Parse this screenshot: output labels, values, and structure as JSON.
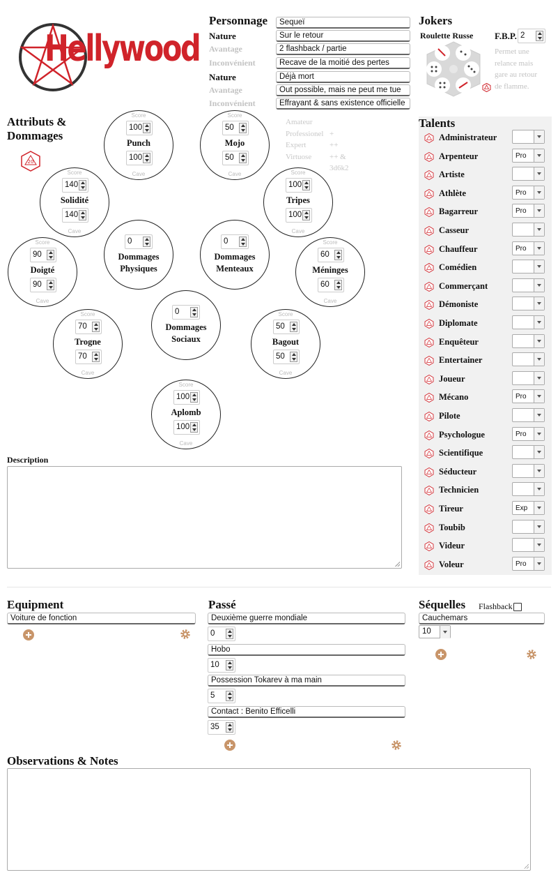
{
  "logo": {
    "text": "Hellywood"
  },
  "personnage": {
    "title": "Personnage",
    "name": "Sequeï",
    "nature_label": "Nature",
    "avantage_label": "Avantage",
    "inconvenient_label": "Inconvénient",
    "nature1": "Sur le retour",
    "avantage1": "2 flashback / partie",
    "inconvenient1": "Recave de la moitié des pertes",
    "nature2": "Déjà mort",
    "avantage2": "Out possible, mais ne peut me tue",
    "inconvenient2": "Effrayant & sans existence officielle"
  },
  "jokers": {
    "title": "Jokers",
    "roulette_label": "Roulette Russe",
    "fbp_label": "F.B.P.",
    "fbp_value": "2",
    "fbp_note": "Permet une relance mais gare au retour de flamme."
  },
  "attributs": {
    "title": "Attributs & Dommages",
    "score_label": "Score",
    "cave_label": "Cave",
    "levels": [
      {
        "name": "Amateur",
        "mod": ""
      },
      {
        "name": "Professionel",
        "mod": "+"
      },
      {
        "name": "Expert",
        "mod": "++"
      },
      {
        "name": "Virtuose",
        "mod": "++ & 3d6k2"
      }
    ],
    "punch": {
      "name": "Punch",
      "score": "100",
      "cave": "100"
    },
    "mojo": {
      "name": "Mojo",
      "score": "50",
      "cave": "50"
    },
    "solidite": {
      "name": "Solidité",
      "score": "140",
      "cave": "140"
    },
    "tripes": {
      "name": "Tripes",
      "score": "100",
      "cave": "100"
    },
    "doigte": {
      "name": "Doigté",
      "score": "90",
      "cave": "90"
    },
    "meninges": {
      "name": "Méninges",
      "score": "60",
      "cave": "60"
    },
    "trogne": {
      "name": "Trogne",
      "score": "70",
      "cave": "70"
    },
    "bagout": {
      "name": "Bagout",
      "score": "50",
      "cave": "50"
    },
    "aplomb": {
      "name": "Aplomb",
      "score": "100",
      "cave": "100"
    },
    "dom_phys": {
      "name1": "Dommages",
      "name2": "Physiques",
      "value": "0"
    },
    "dom_ment": {
      "name1": "Dommages",
      "name2": "Menteaux",
      "value": "0"
    },
    "dom_soc": {
      "name1": "Dommages",
      "name2": "Sociaux",
      "value": "0"
    }
  },
  "talents": {
    "title": "Talents",
    "items": [
      {
        "name": "Administrateur",
        "level": ""
      },
      {
        "name": "Arpenteur",
        "level": "Pro"
      },
      {
        "name": "Artiste",
        "level": ""
      },
      {
        "name": "Athlète",
        "level": "Pro"
      },
      {
        "name": "Bagarreur",
        "level": "Pro"
      },
      {
        "name": "Casseur",
        "level": ""
      },
      {
        "name": "Chauffeur",
        "level": "Pro"
      },
      {
        "name": "Comédien",
        "level": ""
      },
      {
        "name": "Commerçant",
        "level": ""
      },
      {
        "name": "Démoniste",
        "level": ""
      },
      {
        "name": "Diplomate",
        "level": ""
      },
      {
        "name": "Enquêteur",
        "level": ""
      },
      {
        "name": "Entertainer",
        "level": ""
      },
      {
        "name": "Joueur",
        "level": ""
      },
      {
        "name": "Mécano",
        "level": "Pro"
      },
      {
        "name": "Pilote",
        "level": ""
      },
      {
        "name": "Psychologue",
        "level": "Pro"
      },
      {
        "name": "Scientifique",
        "level": ""
      },
      {
        "name": "Séducteur",
        "level": ""
      },
      {
        "name": "Technicien",
        "level": ""
      },
      {
        "name": "Tireur",
        "level": "Exp"
      },
      {
        "name": "Toubib",
        "level": ""
      },
      {
        "name": "Videur",
        "level": ""
      },
      {
        "name": "Voleur",
        "level": "Pro"
      }
    ]
  },
  "description": {
    "title": "Description",
    "value": ""
  },
  "equipment": {
    "title": "Equipment",
    "items": [
      "Voiture de fonction"
    ]
  },
  "passe": {
    "title": "Passé",
    "items": [
      {
        "label": "Deuxième guerre mondiale",
        "value": "0"
      },
      {
        "label": "Hobo",
        "value": "10"
      },
      {
        "label": "Possession Tokarev à ma main",
        "value": "5"
      },
      {
        "label": "Contact : Benito Efficelli",
        "value": "35"
      }
    ]
  },
  "sequelles": {
    "title": "Séquelles",
    "flashback_label": "Flashback",
    "flashback_checked": false,
    "items": [
      {
        "label": "Cauchemars",
        "value": "10"
      }
    ]
  },
  "notes": {
    "title": "Observations & Notes",
    "value": ""
  },
  "colors": {
    "accent": "#c8956a",
    "logo_red": "#d0232a"
  }
}
